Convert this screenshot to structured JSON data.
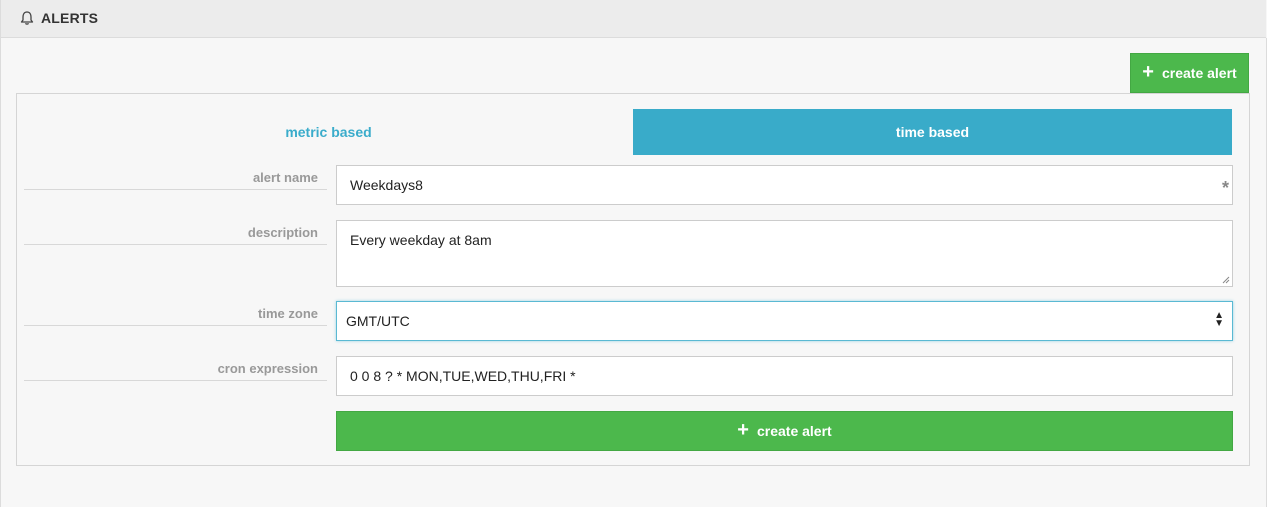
{
  "header": {
    "title": "ALERTS",
    "icon": "bell-icon"
  },
  "toolbar": {
    "create_label": "create alert"
  },
  "tabs": [
    {
      "label": "metric based",
      "active": false
    },
    {
      "label": "time based",
      "active": true
    }
  ],
  "form": {
    "alert_name": {
      "label": "alert name",
      "value": "Weekdays8",
      "required_mark": "*"
    },
    "description": {
      "label": "description",
      "value": "Every weekday at 8am"
    },
    "time_zone": {
      "label": "time zone",
      "value": "GMT/UTC"
    },
    "cron_expression": {
      "label": "cron expression",
      "value": "0 0 8 ? * MON,TUE,WED,THU,FRI *"
    },
    "submit_label": "create alert"
  },
  "colors": {
    "accent": "#39abc9",
    "success": "#4cb84c"
  }
}
